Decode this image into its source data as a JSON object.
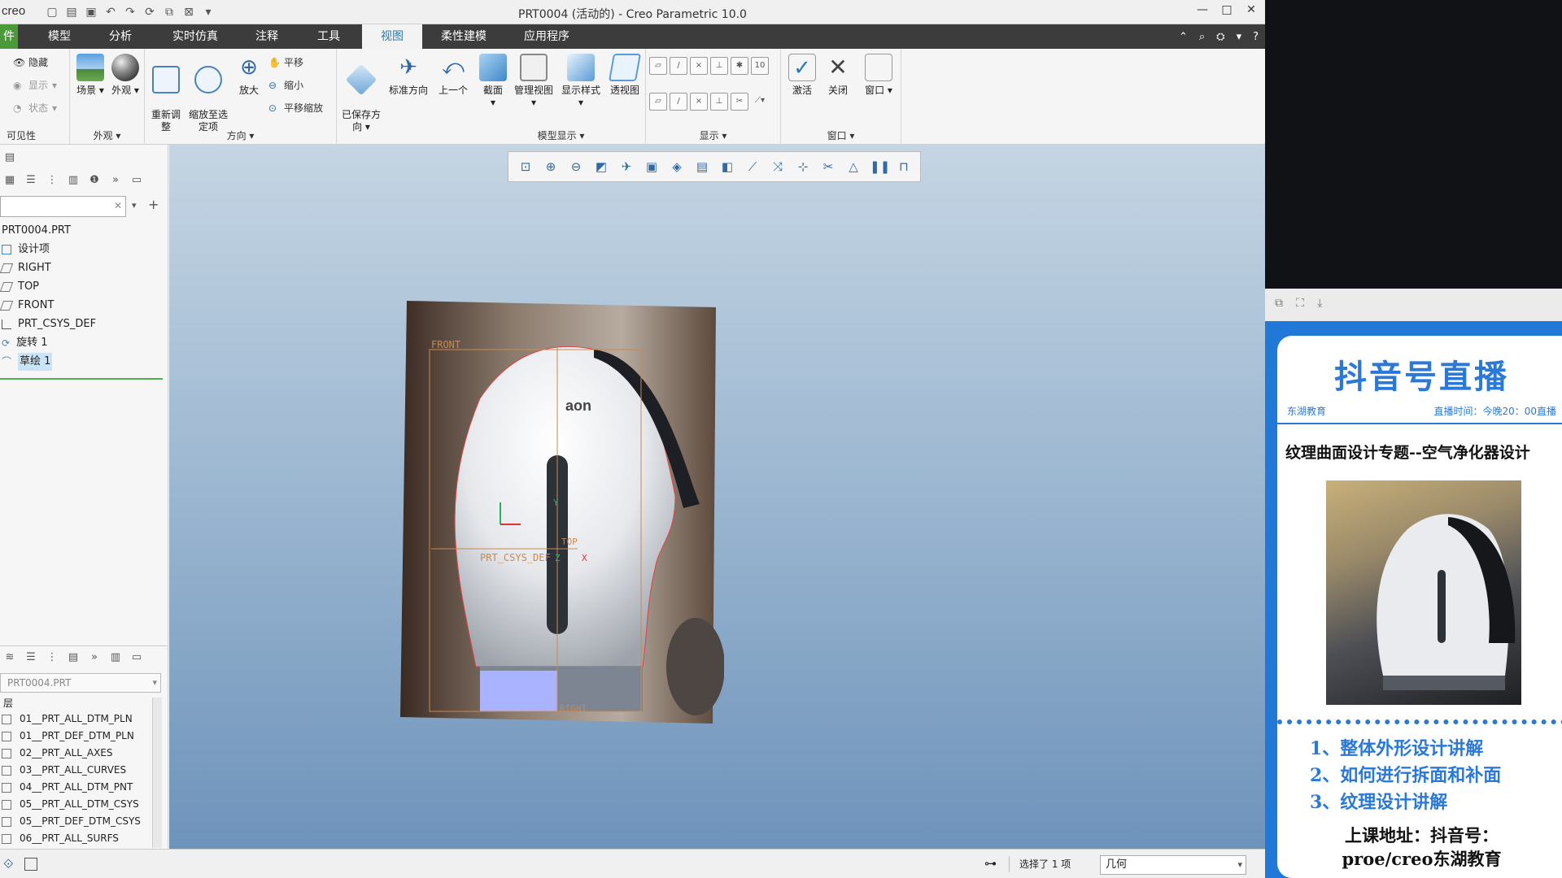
{
  "titlebar": {
    "logo": "creo",
    "title": "PRT0004 (活动的) - Creo Parametric 10.0"
  },
  "menubar": {
    "tabs": [
      "件",
      "模型",
      "分析",
      "实时仿真",
      "注释",
      "工具",
      "视图",
      "柔性建模",
      "应用程序"
    ],
    "active": "视图"
  },
  "ribbon": {
    "visibility": {
      "hide": "隐藏",
      "show": "显示",
      "status": "状态",
      "group": "可见性"
    },
    "appearance": {
      "scene": "场景",
      "look": "外观",
      "group": "外观"
    },
    "orientation": {
      "refit": "重新调\n整",
      "zoom_to_selected": "缩放至选\n定项",
      "zoom_in": "放大",
      "pan": "平移",
      "zoom_out": "缩小",
      "pan_zoom": "平移缩放",
      "group": "方向"
    },
    "saved": {
      "saved_orient": "已保存方\n向",
      "standard": "标准方向",
      "previous": "上一个"
    },
    "model_display": {
      "section": "截面",
      "manage_views": "管理视图",
      "display_style": "显示样式",
      "perspective": "透视图",
      "group": "模型显示"
    },
    "show": {
      "group": "显示"
    },
    "window": {
      "activate": "激活",
      "close": "关闭",
      "window": "窗口",
      "group": "窗口"
    }
  },
  "model_tree": {
    "root": "PRT0004.PRT",
    "items": [
      {
        "label": "设计项",
        "icon": "design-items-icon"
      },
      {
        "label": "RIGHT",
        "icon": "datum-plane-icon"
      },
      {
        "label": "TOP",
        "icon": "datum-plane-icon"
      },
      {
        "label": "FRONT",
        "icon": "datum-plane-icon"
      },
      {
        "label": "PRT_CSYS_DEF",
        "icon": "csys-icon"
      },
      {
        "label": "旋转 1",
        "icon": "revolve-icon"
      },
      {
        "label": "草绘 1",
        "icon": "sketch-icon",
        "selected": true
      }
    ]
  },
  "layers": {
    "dropdown": "PRT0004.PRT",
    "header": "层",
    "items": [
      "01__PRT_ALL_DTM_PLN",
      "01__PRT_DEF_DTM_PLN",
      "02__PRT_ALL_AXES",
      "03__PRT_ALL_CURVES",
      "04__PRT_ALL_DTM_PNT",
      "05__PRT_ALL_DTM_CSYS",
      "05__PRT_DEF_DTM_CSYS",
      "06__PRT_ALL_SURFS"
    ]
  },
  "viewport": {
    "model_logo": "aon",
    "labels": {
      "front": "FRONT",
      "csys": "PRT_CSYS_DEF",
      "top": "TOP",
      "right": "RIGHT",
      "z": "Z",
      "x": "X",
      "y": "Y"
    }
  },
  "status": {
    "selected": "选择了 1 项",
    "filter": "几何"
  },
  "ad": {
    "header": "抖音号直播",
    "org": "东湖教育",
    "time": "直播时间：今晚20：00直播",
    "topic": "纹理曲面设计专题--空气净化器设计",
    "points": [
      "1、整体外形设计讲解",
      "2、如何进行拆面和补面",
      "3、纹理设计讲解"
    ],
    "address_line1": "上课地址：抖音号：",
    "address_line2": "proe/creo东湖教育"
  },
  "colors": {
    "accent": "#2a78d8",
    "menubar": "#3c3c3c",
    "file_tab": "#4a9a3a"
  }
}
